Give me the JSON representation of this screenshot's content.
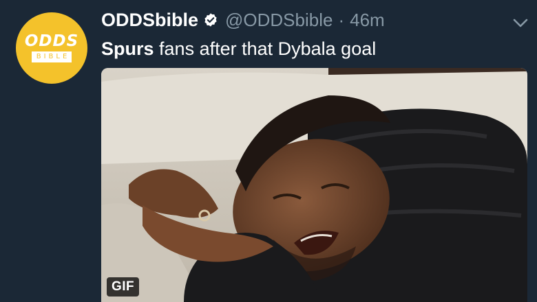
{
  "tweet": {
    "author_name": "ODDSbible",
    "handle": "@ODDSbible",
    "separator": "·",
    "time": "46m",
    "text_bold": "Spurs",
    "text_rest": " fans after that Dybala goal",
    "verified": true
  },
  "avatar": {
    "line1": "ODDS",
    "line2": "BIBLE",
    "color": "#f4c22b"
  },
  "media": {
    "badge": "GIF",
    "description_icon": "crying-man-gif"
  },
  "colors": {
    "background": "#1b2836",
    "secondary_text": "#8899a6",
    "verified_badge": "#ffffff"
  }
}
